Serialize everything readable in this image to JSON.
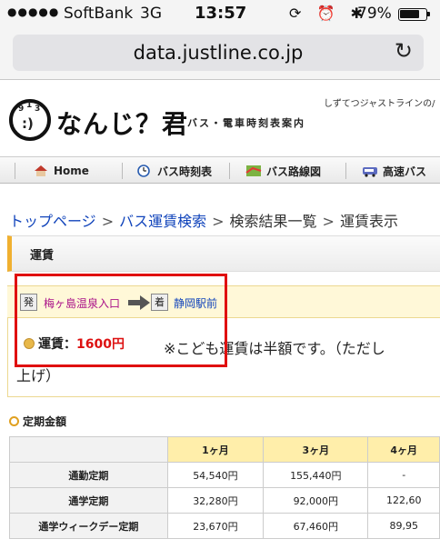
{
  "status_bar": {
    "signal": "●●●●●",
    "carrier": "SoftBank",
    "network": "3G",
    "time": "13:57",
    "icons": "⟳ ⏰ ✱",
    "battery_pct": "79%",
    "battery_level": 0.79
  },
  "browser": {
    "url": "data.justline.co.jp"
  },
  "site": {
    "tagline": "しずてつジャストラインの/",
    "logo_text": "なんじ？君",
    "logo_sub": "バス・電車時刻表案内"
  },
  "nav": {
    "items": [
      "Home",
      "バス時刻表",
      "バス路線図",
      "高速バス"
    ]
  },
  "breadcrumb": {
    "items": [
      "トップページ",
      "バス運賃検索",
      "検索結果一覧",
      "運賃表示"
    ],
    "separator": ">"
  },
  "fare": {
    "section_title": "運賃",
    "from_badge": "発",
    "from_stop": "梅ヶ島温泉入口",
    "to_badge": "着",
    "to_stop": "静岡駅前",
    "label": "運賃：",
    "amount": "1600円",
    "note": "※こども運賃は半額です。（ただし",
    "note_cont": "上げ）"
  },
  "pass": {
    "section_title": "定期金額",
    "headers": [
      "",
      "1ヶ月",
      "3ヶ月",
      "4ヶ月"
    ],
    "rows": [
      {
        "label": "通勤定期",
        "values": [
          "54,540円",
          "155,440円",
          "-"
        ]
      },
      {
        "label": "通学定期",
        "values": [
          "32,280円",
          "92,000円",
          "122,60"
        ]
      },
      {
        "label": "通学ウィークデー定期",
        "values": [
          "23,670円",
          "67,460円",
          "89,95"
        ]
      }
    ]
  },
  "colors": {
    "accent": "#f0b030",
    "link": "#1144bb",
    "fare_amount": "#dd1111",
    "highlight": "#e01010"
  }
}
